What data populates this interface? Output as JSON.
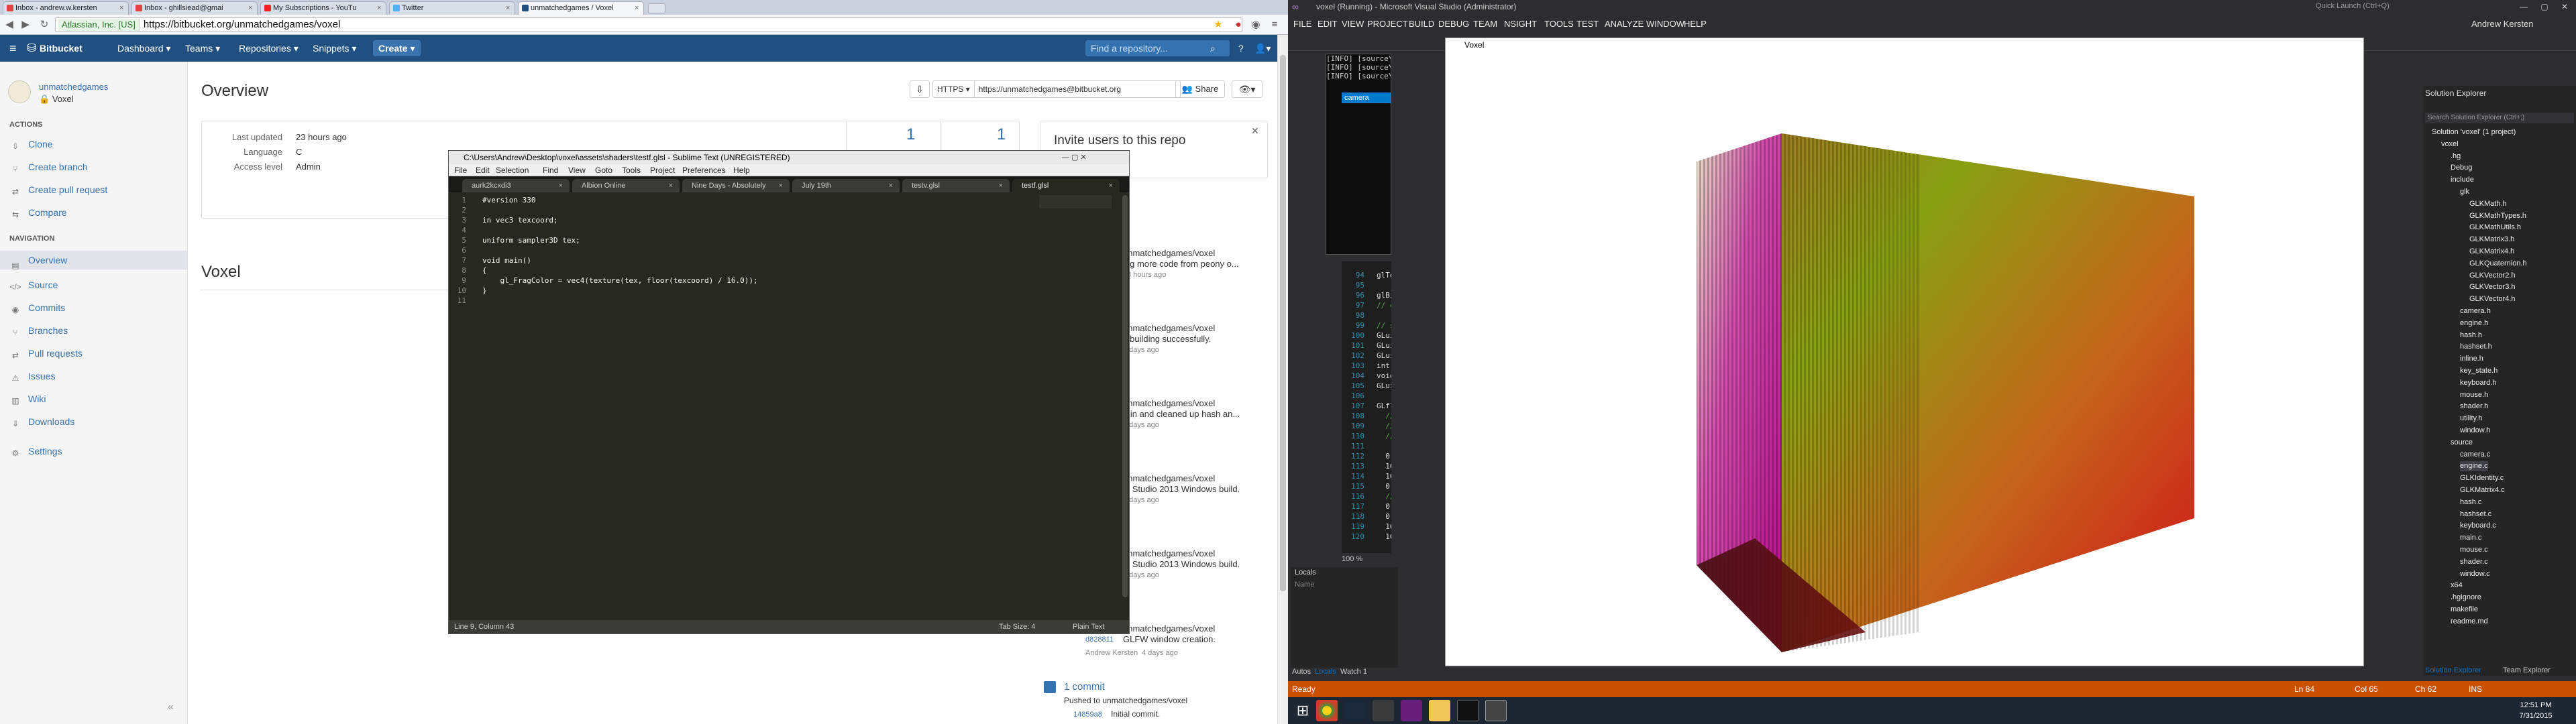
{
  "colors": {
    "bb_blue": "#205081",
    "bb_link": "#3572b0",
    "sublime_bg": "#272822",
    "vs_orange": "#ca5100",
    "vs_bg": "#2d2d30"
  },
  "browser": {
    "tabs": [
      {
        "label": "Inbox - andrew.w.kersten",
        "icon": "gmail-icon"
      },
      {
        "label": "Inbox - ghillsiead@gmai",
        "icon": "gmail-icon"
      },
      {
        "label": "My Subscriptions - YouTu",
        "icon": "youtube-icon"
      },
      {
        "label": "Twitter",
        "icon": "twitter-icon"
      },
      {
        "label": "unmatchedgames / Voxel",
        "icon": "bitbucket-icon"
      }
    ],
    "ev_label": "Atlassian, Inc. [US]",
    "url": "https://bitbucket.org/unmatchedgames/voxel"
  },
  "bb": {
    "brand": "Bitbucket",
    "nav": [
      "Dashboard ▾",
      "Teams ▾",
      "Repositories ▾",
      "Snippets ▾"
    ],
    "create": "Create ▾",
    "search_placeholder": "Find a repository...",
    "owner": "unmatchedgames",
    "repo": "Voxel",
    "actions_heading": "ACTIONS",
    "actions": [
      "Clone",
      "Create branch",
      "Create pull request",
      "Compare"
    ],
    "nav_heading": "NAVIGATION",
    "navigation": [
      "Overview",
      "Source",
      "Commits",
      "Branches",
      "Pull requests",
      "Issues",
      "Wiki",
      "Downloads",
      "Settings"
    ],
    "page_title": "Overview",
    "protocol": "HTTPS ▾",
    "clone_url": "https://unmatchedgames@bitbucket.org",
    "share": "Share",
    "info": [
      {
        "k": "Last updated",
        "v": "23 hours ago"
      },
      {
        "k": "Language",
        "v": "C"
      },
      {
        "k": "Access level",
        "v": "Admin"
      }
    ],
    "stats": [
      "1",
      "1"
    ],
    "invite_title": "Invite users to this repo",
    "readme_title": "Voxel",
    "activity": [
      {
        "repo": "unmatchedgames/voxel",
        "msg": "ing more code from peony o...",
        "when": "23 hours ago"
      },
      {
        "repo": "unmatchedgames/voxel",
        "msg": "x building successfully.",
        "when": "2 days ago"
      },
      {
        "repo": "unmatchedgames/voxel",
        "msg": "d in and cleaned up hash an...",
        "when": "2 days ago"
      },
      {
        "repo": "unmatchedgames/voxel",
        "msg": "al Studio 2013 Windows build.",
        "when": "2 days ago"
      },
      {
        "repo": "unmatchedgames/voxel",
        "msg": "al Studio 2013 Windows build.",
        "when": "3 days ago"
      },
      {
        "repo": "unmatchedgames/voxel",
        "hash": "d828811",
        "msg": "GLFW window creation.",
        "author": "Andrew Kersten",
        "when": "4 days ago"
      }
    ],
    "commit_count": "1 commit",
    "pushed": "Pushed to unmatchedgames/voxel",
    "last_hash": "14859a8",
    "last_msg": "Initial commit."
  },
  "sublime": {
    "title": "C:\\Users\\Andrew\\Desktop\\voxel\\assets\\shaders\\testf.glsl - Sublime Text (UNREGISTERED)",
    "menu": [
      "File",
      "Edit",
      "Selection",
      "Find",
      "View",
      "Goto",
      "Tools",
      "Project",
      "Preferences",
      "Help"
    ],
    "tabs": [
      "aurk2kcxdi3",
      "Albion Online",
      "Nine Days - Absolutely",
      "July 19th",
      "testv.glsl",
      "testf.glsl"
    ],
    "lines": [
      {
        "n": "1",
        "t": "#version 330"
      },
      {
        "n": "2",
        "t": ""
      },
      {
        "n": "3",
        "t": "in vec3 texcoord;"
      },
      {
        "n": "4",
        "t": ""
      },
      {
        "n": "5",
        "t": "uniform sampler3D tex;"
      },
      {
        "n": "6",
        "t": ""
      },
      {
        "n": "7",
        "t": "void main()"
      },
      {
        "n": "8",
        "t": "{"
      },
      {
        "n": "9",
        "t": "    gl_FragColor = vec4(texture(tex, floor(texcoord) / 16.0));"
      },
      {
        "n": "10",
        "t": "}"
      },
      {
        "n": "11",
        "t": ""
      }
    ],
    "status_left": "Line 9, Column 43",
    "tab_size": "Tab Size: 4",
    "syntax": "Plain Text"
  },
  "vs": {
    "title": "voxel (Running) - Microsoft Visual Studio (Administrator)",
    "quick_launch": "Quick Launch (Ctrl+Q)",
    "user": "Andrew Kersten",
    "menu": [
      "FILE",
      "EDIT",
      "VIEW",
      "PROJECT",
      "BUILD",
      "DEBUG",
      "TEAM",
      "NSIGHT",
      "TOOLS",
      "TEST",
      "ANALYZE",
      "WINDOW",
      "HELP"
    ],
    "console": [
      "[INFO] [source\\window",
      "[INFO] [source\\window",
      "[INFO] [source\\window"
    ],
    "editor_tab": "camera",
    "editor_lines": [
      {
        "n": "94",
        "t": "glTexImage3D(GL_TE"
      },
      {
        "n": "95",
        "t": ""
      },
      {
        "n": "96",
        "t": "glBindTexture(GL_"
      },
      {
        "n": "97",
        "t": "// end 3d texture"
      },
      {
        "n": "98",
        "t": ""
      },
      {
        "n": "99",
        "t": "// start mesh setu"
      },
      {
        "n": "100",
        "t": "GLuint vao;"
      },
      {
        "n": "101",
        "t": "GLuint vbo;"
      },
      {
        "n": "102",
        "t": "GLuint evbo;"
      },
      {
        "n": "103",
        "t": "int indices;"
      },
      {
        "n": "104",
        "t": "void* instance_buf"
      },
      {
        "n": "105",
        "t": "GLuint instance_vb"
      },
      {
        "n": "106",
        "t": ""
      },
      {
        "n": "107",
        "t": "GLfloat buffer[] ="
      },
      {
        "n": "108",
        "t": "  //0.0, 0.0, 0."
      },
      {
        "n": "109",
        "t": "  //0.0, 16.0, 0"
      },
      {
        "n": "110",
        "t": "  //16.0, 0.0, 0."
      },
      {
        "n": "111",
        "t": ""
      },
      {
        "n": "112",
        "t": "  0.0, 0.0, 16."
      },
      {
        "n": "113",
        "t": "  16.0, 0.0, 16."
      },
      {
        "n": "114",
        "t": "  16.0, 16.0, 16"
      },
      {
        "n": "115",
        "t": "  0.0, 16.0, 16"
      },
      {
        "n": "116",
        "t": "  // back face"
      },
      {
        "n": "117",
        "t": "  0.0, 0.0, 0.0"
      },
      {
        "n": "118",
        "t": "  0.0, 16.0, 0.0"
      },
      {
        "n": "119",
        "t": "  16.0, 16.0, 0."
      },
      {
        "n": "120",
        "t": "  16.0, 0.0, 0.0"
      }
    ],
    "zoom": "100 %",
    "locals": "Locals",
    "locals_col": "Name",
    "bottom_tabs": [
      "Autos",
      "Locals",
      "Watch 1"
    ],
    "window_title": "Voxel",
    "solution_title": "Solution Explorer",
    "solution_search": "Search Solution Explorer (Ctrl+;)",
    "tree": [
      {
        "d": 0,
        "t": "Solution 'voxel' (1 project)"
      },
      {
        "d": 1,
        "t": "voxel"
      },
      {
        "d": 2,
        "t": ".hg"
      },
      {
        "d": 2,
        "t": "Debug"
      },
      {
        "d": 2,
        "t": "include"
      },
      {
        "d": 3,
        "t": "glk"
      },
      {
        "d": 4,
        "t": "GLKMath.h"
      },
      {
        "d": 4,
        "t": "GLKMathTypes.h"
      },
      {
        "d": 4,
        "t": "GLKMathUtils.h"
      },
      {
        "d": 4,
        "t": "GLKMatrix3.h"
      },
      {
        "d": 4,
        "t": "GLKMatrix4.h"
      },
      {
        "d": 4,
        "t": "GLKQuaternion.h"
      },
      {
        "d": 4,
        "t": "GLKVector2.h"
      },
      {
        "d": 4,
        "t": "GLKVector3.h"
      },
      {
        "d": 4,
        "t": "GLKVector4.h"
      },
      {
        "d": 3,
        "t": "camera.h"
      },
      {
        "d": 3,
        "t": "engine.h"
      },
      {
        "d": 3,
        "t": "hash.h"
      },
      {
        "d": 3,
        "t": "hashset.h"
      },
      {
        "d": 3,
        "t": "inline.h"
      },
      {
        "d": 3,
        "t": "key_state.h"
      },
      {
        "d": 3,
        "t": "keyboard.h"
      },
      {
        "d": 3,
        "t": "mouse.h"
      },
      {
        "d": 3,
        "t": "shader.h"
      },
      {
        "d": 3,
        "t": "utility.h"
      },
      {
        "d": 3,
        "t": "window.h"
      },
      {
        "d": 2,
        "t": "source"
      },
      {
        "d": 3,
        "t": "camera.c"
      },
      {
        "d": 3,
        "t": "engine.c"
      },
      {
        "d": 3,
        "t": "GLKIdentity.c"
      },
      {
        "d": 3,
        "t": "GLKMatrix4.c"
      },
      {
        "d": 3,
        "t": "hash.c"
      },
      {
        "d": 3,
        "t": "hashset.c"
      },
      {
        "d": 3,
        "t": "keyboard.c"
      },
      {
        "d": 3,
        "t": "main.c"
      },
      {
        "d": 3,
        "t": "mouse.c"
      },
      {
        "d": 3,
        "t": "shader.c"
      },
      {
        "d": 3,
        "t": "window.c"
      },
      {
        "d": 2,
        "t": "x64"
      },
      {
        "d": 2,
        "t": ".hgignore"
      },
      {
        "d": 2,
        "t": "makefile"
      },
      {
        "d": 2,
        "t": "readme.md"
      }
    ],
    "se_tabs": [
      "Solution Explorer",
      "Team Explorer"
    ],
    "status": "Ready",
    "ln": "Ln 84",
    "col": "Col 65",
    "ch": "Ch 62",
    "ins": "INS"
  },
  "taskbar": {
    "time": "12:51 PM",
    "date": "7/31/2015"
  }
}
